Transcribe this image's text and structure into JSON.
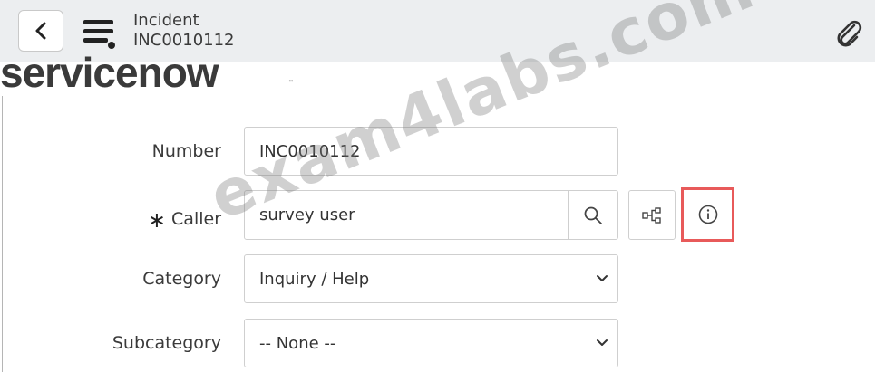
{
  "header": {
    "record_type": "Incident",
    "record_number": "INC0010112",
    "back_icon": "chevron-left-icon",
    "menu_icon": "hamburger-menu-icon",
    "attachment_icon": "paperclip-icon"
  },
  "branding": {
    "logo_text": "servicenow",
    "trademark": "™"
  },
  "form": {
    "number": {
      "label": "Number",
      "value": "INC0010112"
    },
    "caller": {
      "label": "Caller",
      "required_marker": "∗",
      "value": "survey user",
      "lookup_icon": "search-icon",
      "dependency_icon": "relationship-graph-icon",
      "info_icon": "info-icon"
    },
    "category": {
      "label": "Category",
      "value": "Inquiry / Help"
    },
    "subcategory": {
      "label": "Subcategory",
      "value": "-- None --"
    }
  },
  "watermark": "exam4labs.com",
  "colors": {
    "highlight": "#e85a5a",
    "header_bg": "#eceef0",
    "logo_o": "#7fc242"
  }
}
